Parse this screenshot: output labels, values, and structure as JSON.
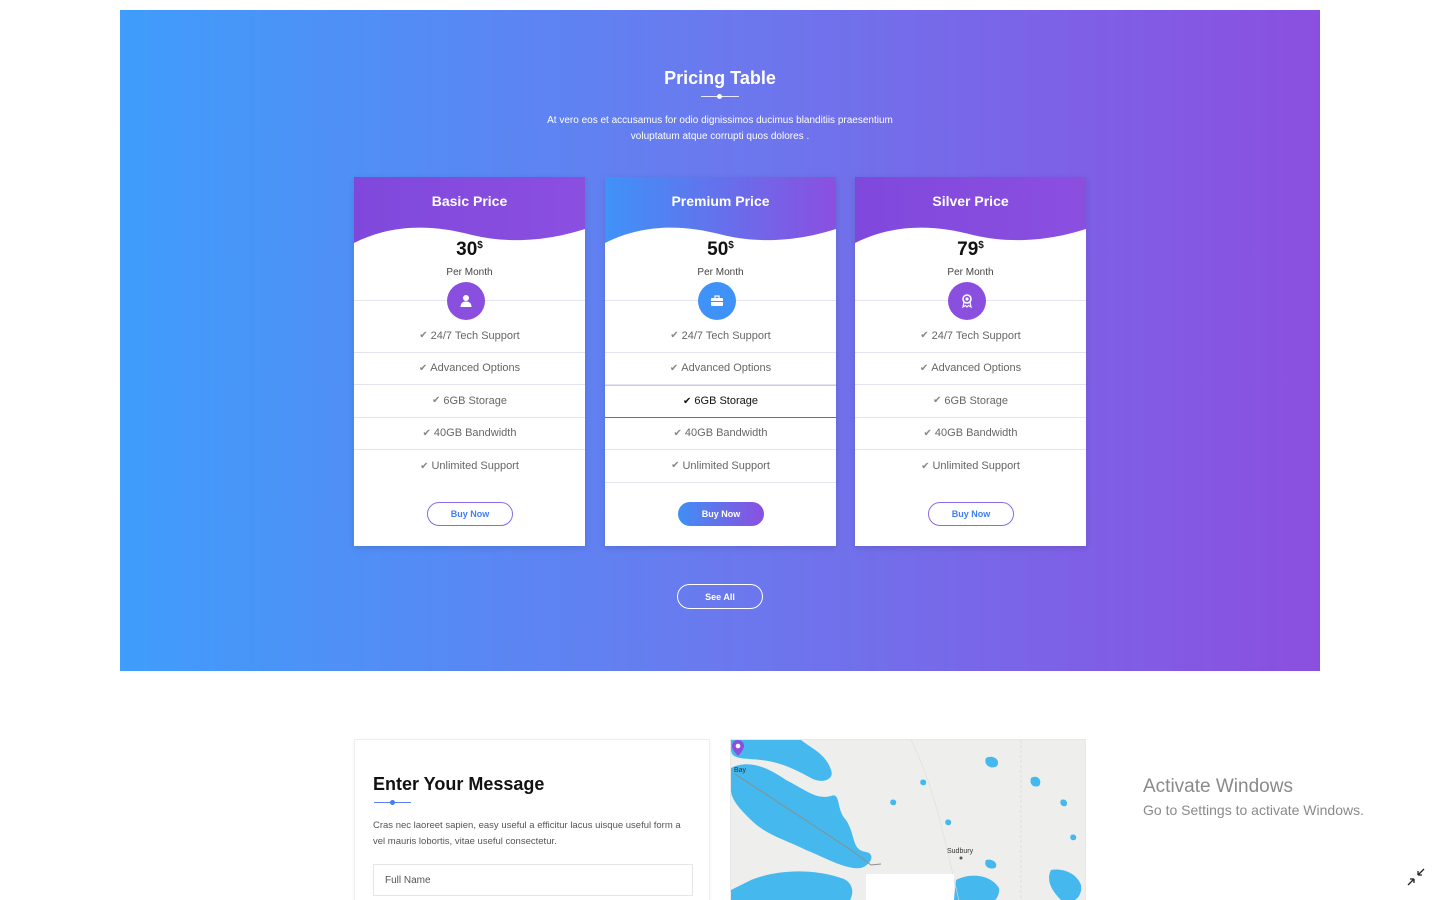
{
  "pricing": {
    "title": "Pricing Table",
    "description": "At vero eos et accusamus for odio dignissimos ducimus blanditiis praesentium voluptatum atque corrupti quos dolores .",
    "plans": [
      {
        "name": "Basic Price",
        "price": "30",
        "currency": "$",
        "period": "Per Month",
        "icon": "user-icon",
        "features": [
          "24/7 Tech Support",
          "Advanced Options",
          "6GB Storage",
          "40GB Bandwidth",
          "Unlimited Support"
        ],
        "button": "Buy Now"
      },
      {
        "name": "Premium Price",
        "price": "50",
        "currency": "$",
        "period": "Per Month",
        "icon": "briefcase-icon",
        "features": [
          "24/7 Tech Support",
          "Advanced Options",
          "6GB Storage",
          "40GB Bandwidth",
          "Unlimited Support"
        ],
        "button": "Buy Now"
      },
      {
        "name": "Silver Price",
        "price": "79",
        "currency": "$",
        "period": "Per Month",
        "icon": "award-icon",
        "features": [
          "24/7 Tech Support",
          "Advanced Options",
          "6GB Storage",
          "40GB Bandwidth",
          "Unlimited Support"
        ],
        "button": "Buy Now"
      }
    ],
    "see_all": "See All"
  },
  "contact": {
    "title": "Enter Your Message",
    "text": "Cras nec laoreet sapien, easy useful a efficitur lacus uisque useful form a vel mauris lobortis, vitae useful  consectetur.",
    "full_name_placeholder": "Full Name"
  },
  "map": {
    "label_city": "Sudbury",
    "label_bay": "Bay"
  },
  "windows": {
    "title": "Activate Windows",
    "subtitle": "Go to Settings to activate Windows."
  },
  "colors": {
    "gradient_start": "#3f9dfb",
    "gradient_end": "#8b4fe0",
    "accent_purple": "#8b4fe0",
    "accent_blue": "#3f8ff5",
    "water": "#45b8ee"
  }
}
